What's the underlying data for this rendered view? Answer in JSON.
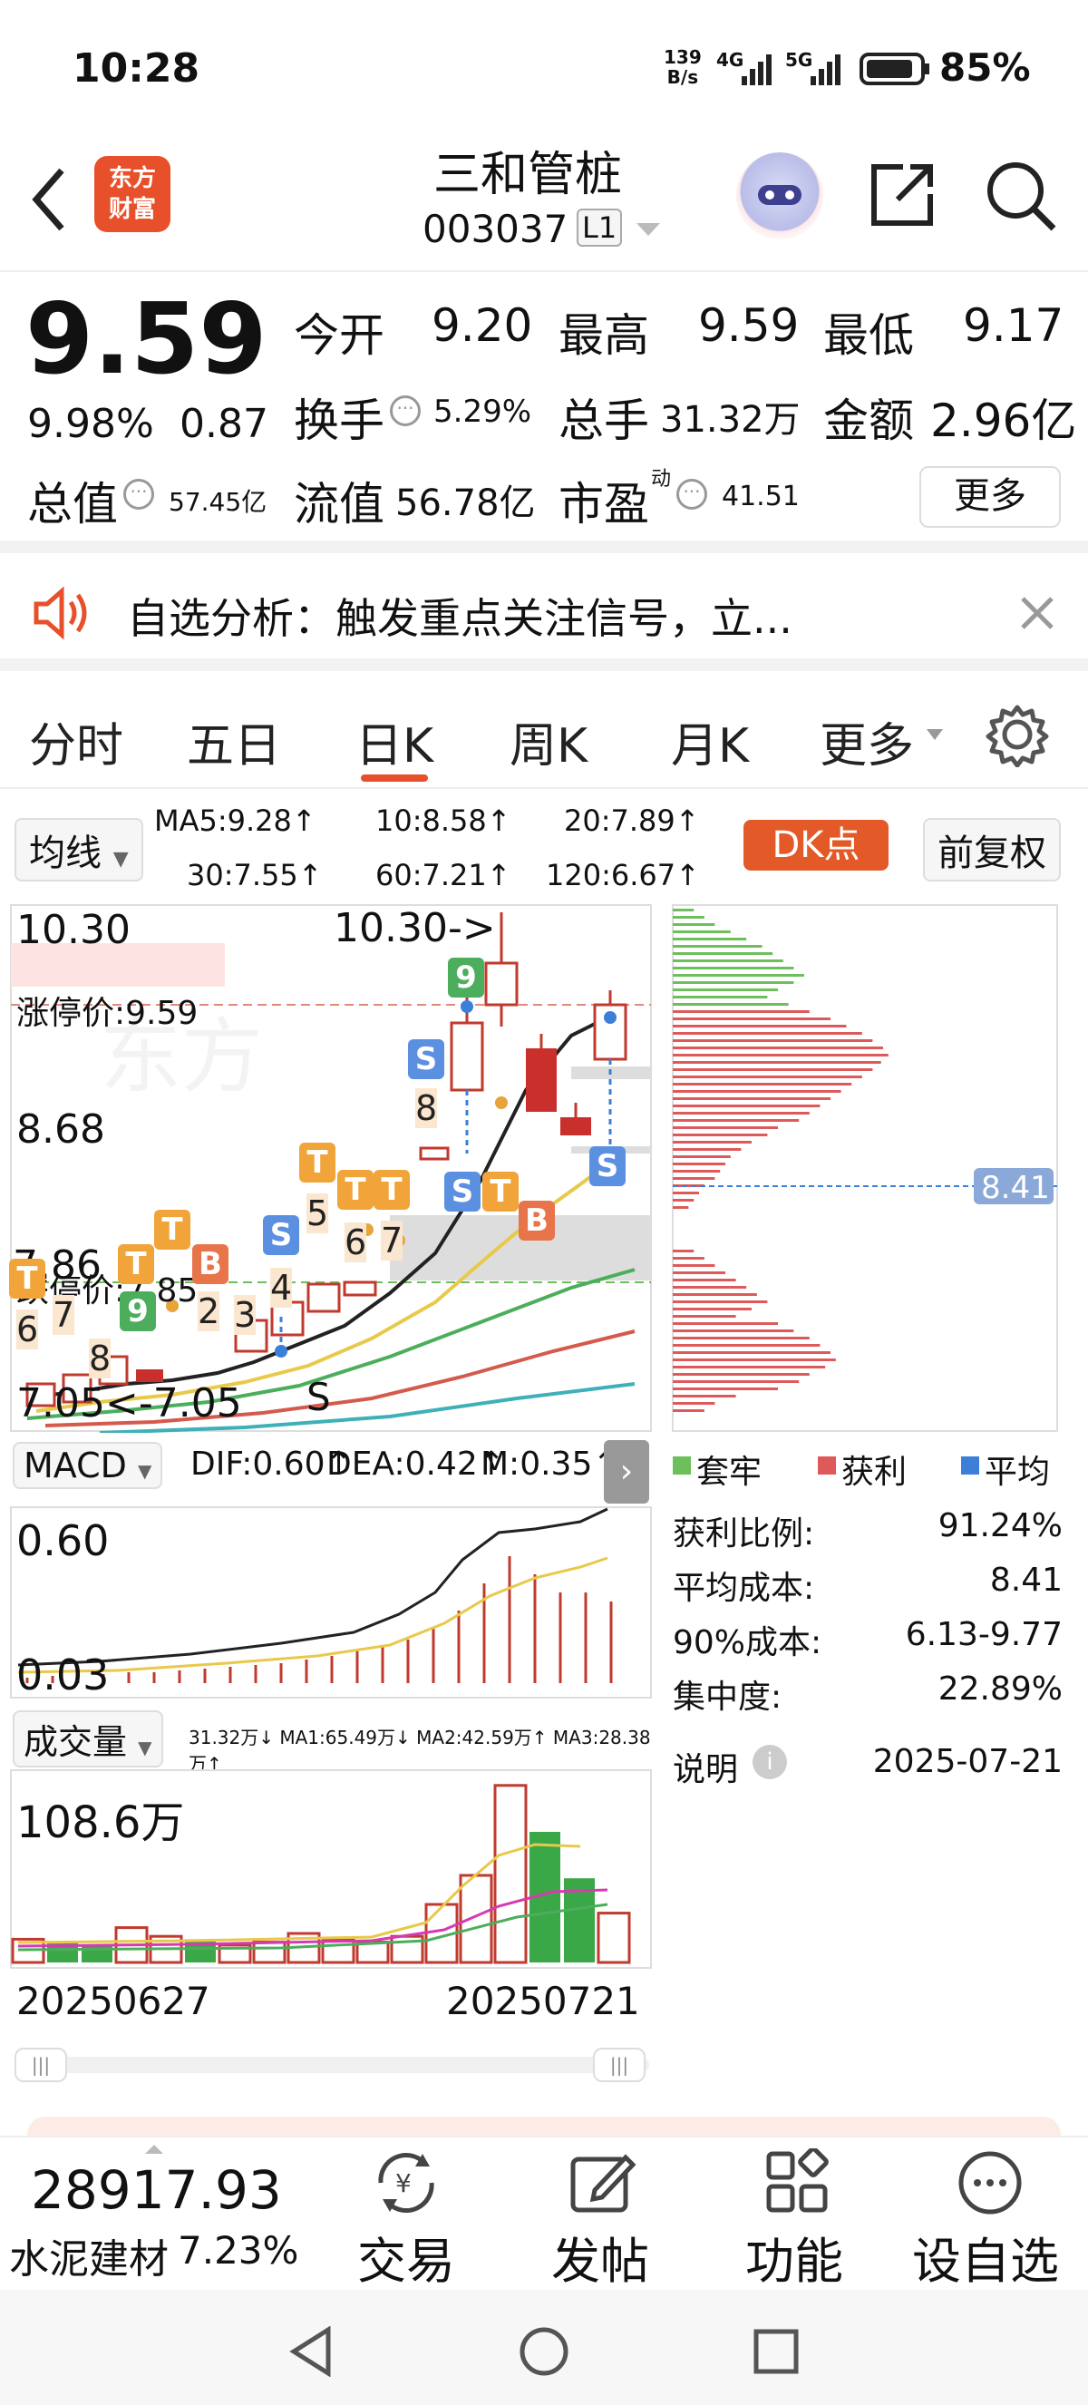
{
  "status_bar": {
    "time": "10:28",
    "net_speed_top": "139",
    "net_speed_bottom": "B/s",
    "net1": "4G",
    "net2": "5G",
    "battery": "85%"
  },
  "header": {
    "logo_line1": "东方",
    "logo_line2": "财富",
    "stock_name": "三和管桩",
    "stock_code": "003037",
    "level_badge": "L1"
  },
  "quote": {
    "price": "9.59",
    "change_pct": "9.98%",
    "change_amt": "0.87",
    "open_label": "今开",
    "open": "9.20",
    "high_label": "最高",
    "high": "9.59",
    "low_label": "最低",
    "low": "9.17",
    "turnover_label": "换手",
    "turnover": "5.29%",
    "volume_label": "总手",
    "volume": "31.32万",
    "amount_label": "金额",
    "amount": "2.96亿",
    "mktcap_label": "总值",
    "mktcap": "57.45亿",
    "float_label": "流值",
    "float": "56.78亿",
    "pe_label": "市盈",
    "pe_sup": "动",
    "pe": "41.51",
    "more_button": "更多"
  },
  "banner": {
    "text": "自选分析：触发重点关注信号，立..."
  },
  "tabs": [
    {
      "label": "分时"
    },
    {
      "label": "五日"
    },
    {
      "label": "日K"
    },
    {
      "label": "周K"
    },
    {
      "label": "月K"
    },
    {
      "label": "更多"
    }
  ],
  "ma_bar": {
    "selector": "均线",
    "ma5": "MA5:9.28↑",
    "ma10": "10:8.58↑",
    "ma20": "20:7.89↑",
    "ma30": "30:7.55↑",
    "ma60": "60:7.21↑",
    "ma120": "120:6.67↑",
    "dk_button": "DK点",
    "fq_button": "前复权"
  },
  "kchart": {
    "y_top": "10.30",
    "y_mid": "8.68",
    "y_low": "7.86",
    "y_bottom": "7.05",
    "high_marker": "10.30->",
    "low_marker": "7.05<-7.05",
    "limit_up_label": "涨停价:9.59",
    "limit_down_label": "跌停价:7.85",
    "s_marker": "S"
  },
  "chip_dist": {
    "avg_cost_tag": "8.41",
    "legend_trapped": "套牢",
    "legend_profit": "获利",
    "legend_avg": "平均",
    "colors": {
      "trapped": "#6cbf5a",
      "profit": "#de5a5a",
      "avg": "#3b7fd9"
    }
  },
  "macd": {
    "selector": "MACD",
    "dif": "DIF:0.60↑",
    "dea": "DEA:0.42↑",
    "m": "M:0.35↑",
    "y_top": "0.60",
    "y_bottom": "0.03"
  },
  "volume": {
    "selector": "成交量",
    "stats": "31.32万↓ MA1:65.49万↓ MA2:42.59万↑ MA3:28.38万↑",
    "y_top": "108.6万",
    "date_start": "20250627",
    "date_end": "20250721"
  },
  "chip_stats": [
    {
      "label": "获利比例:",
      "value": "91.24%"
    },
    {
      "label": "平均成本:",
      "value": "8.41"
    },
    {
      "label": "90%成本:",
      "value": "6.13-9.77"
    },
    {
      "label": "集中度:",
      "value": "22.89%"
    }
  ],
  "chip_note": {
    "label": "说明",
    "date": "2025-07-21"
  },
  "bottom_bar": {
    "index_value": "28917.93",
    "sector_name": "水泥建材",
    "sector_pct": "7.23%",
    "trade": "交易",
    "post": "发帖",
    "function": "功能",
    "watch": "设自选"
  },
  "accent_colors": {
    "up": "#e23b2e",
    "down": "#3aa846",
    "logo": "#e8502b",
    "dk": "#e35a28"
  }
}
